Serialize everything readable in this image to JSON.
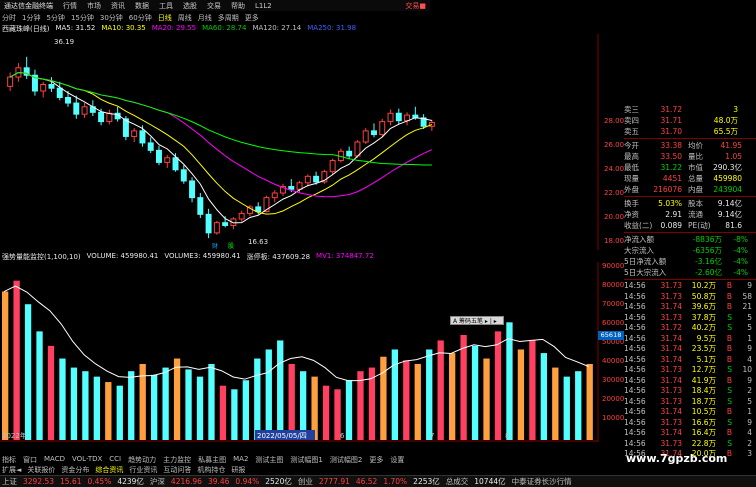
{
  "menubar": {
    "title": "通达信金融终端",
    "items": [
      "行情",
      "市场",
      "资讯",
      "数据",
      "工具",
      "选股",
      "交易",
      "帮助",
      "L1L2"
    ],
    "brand": "交易■"
  },
  "periods": {
    "items": [
      "分时",
      "1分钟",
      "5分钟",
      "15分钟",
      "30分钟",
      "60分钟",
      "日线",
      "周线",
      "月线",
      "多周期",
      "更多"
    ],
    "active": "日线"
  },
  "ma_legend": {
    "name": "西藏珠峰(日线)",
    "ma5": "MA5: 31.52",
    "ma10": "MA10: 30.35",
    "ma20": "MA20: 29.55",
    "ma60": "MA60: 28.74",
    "ma120": "MA120: 27.14",
    "ma250": "MA250: 31.98"
  },
  "vol_legend": {
    "name": "强势量能监控(1,100,10)",
    "volume": "VOLUME: 459980.41",
    "volume3": "VOLUME3: 459980.41",
    "zhangting": "涨停板: 437609.28",
    "mv1": "MV1: 374847.72"
  },
  "price_axis": [
    "28.00",
    "26.00",
    "24.00",
    "22.00",
    "20.00",
    "18.00"
  ],
  "vol_axis": [
    "90000",
    "80000",
    "70000",
    "60000",
    "50000",
    "40000",
    "30000",
    "20000",
    "10000"
  ],
  "chart_annotations": {
    "high": "36.19",
    "low": "16.63",
    "date_marker": "2022/05/05/四",
    "year_left": "2022年",
    "xaxis_labels": [
      "2022年",
      "2022/05/05/四",
      "6",
      "7",
      "8"
    ],
    "marker_cai": "财",
    "marker_gu": "股",
    "floating_btn": "A 筹码五笔 ▸ | ▸",
    "vol_marker": "65618"
  },
  "quote": {
    "ask": [
      {
        "label": "卖三",
        "price": "31.72",
        "vol": "3"
      },
      {
        "label": "卖四",
        "price": "31.71",
        "vol": "48.0万"
      },
      {
        "label": "卖五",
        "price": "31.70",
        "vol": "65.5万"
      }
    ],
    "rows": [
      {
        "k": "今开",
        "v": "33.38",
        "k2": "均价",
        "v2": "41.95"
      },
      {
        "k": "最高",
        "v": "33.50",
        "k2": "量比",
        "v2": "1.05"
      },
      {
        "k": "最低",
        "v": "31.22",
        "k2": "市值",
        "v2": "290.3亿"
      },
      {
        "k": "现量",
        "v": "4451",
        "k2": "总量",
        "v2": "459980"
      },
      {
        "k": "外盘",
        "v": "216076",
        "k2": "内盘",
        "v2": "243904"
      },
      {
        "k": "换手",
        "v": "5.03%",
        "k2": "股本",
        "v2": "9.14亿"
      },
      {
        "k": "净资",
        "v": "2.91",
        "k2": "流通",
        "v2": "9.14亿"
      },
      {
        "k": "收益(二)",
        "v": "0.089",
        "k2": "PE(动)",
        "v2": "81.6"
      }
    ],
    "flows": [
      {
        "label": "净流入额",
        "value": "-8836万",
        "pct": "-8%"
      },
      {
        "label": "大宗流入",
        "value": "-6356万",
        "pct": "-4%"
      },
      {
        "label": "5日净流入额",
        "value": "-3.16亿",
        "pct": "-4%"
      },
      {
        "label": "5日大宗流入",
        "value": "-2.60亿",
        "pct": "-4%"
      }
    ]
  },
  "trades": [
    {
      "t": "14:56",
      "p": "31.73",
      "v": "10.2万",
      "bs": "B",
      "n": "9"
    },
    {
      "t": "14:56",
      "p": "31.73",
      "v": "50.8万",
      "bs": "B",
      "n": "58"
    },
    {
      "t": "14:56",
      "p": "31.74",
      "v": "39.6万",
      "bs": "B",
      "n": "21"
    },
    {
      "t": "14:56",
      "p": "31.73",
      "v": "37.8万",
      "bs": "S",
      "n": "5"
    },
    {
      "t": "14:56",
      "p": "31.72",
      "v": "40.2万",
      "bs": "S",
      "n": "5"
    },
    {
      "t": "14:56",
      "p": "31.74",
      "v": "9.5万",
      "bs": "B",
      "n": "1"
    },
    {
      "t": "14:56",
      "p": "31.74",
      "v": "23.5万",
      "bs": "B",
      "n": "9"
    },
    {
      "t": "14:56",
      "p": "31.74",
      "v": "5.1万",
      "bs": "B",
      "n": "4"
    },
    {
      "t": "14:56",
      "p": "31.73",
      "v": "12.7万",
      "bs": "S",
      "n": "10"
    },
    {
      "t": "14:56",
      "p": "31.74",
      "v": "41.9万",
      "bs": "B",
      "n": "9"
    },
    {
      "t": "14:56",
      "p": "31.73",
      "v": "18.4万",
      "bs": "S",
      "n": "2"
    },
    {
      "t": "14:56",
      "p": "31.73",
      "v": "18.7万",
      "bs": "S",
      "n": "5"
    },
    {
      "t": "14:56",
      "p": "31.74",
      "v": "10.5万",
      "bs": "B",
      "n": "1"
    },
    {
      "t": "14:56",
      "p": "31.73",
      "v": "16.6万",
      "bs": "S",
      "n": "9"
    },
    {
      "t": "14:56",
      "p": "31.74",
      "v": "16.4万",
      "bs": "B",
      "n": "4"
    },
    {
      "t": "14:56",
      "p": "31.73",
      "v": "22.8万",
      "bs": "S",
      "n": "2"
    },
    {
      "t": "14:56",
      "p": "31.74",
      "v": "20.0万",
      "bs": "B",
      "n": "3"
    }
  ],
  "bottom_tabs": [
    "指标",
    "窗口",
    "MACD",
    "VOL-TDX",
    "CCI",
    "趋势动力",
    "主力监控",
    "私募主图",
    "MA2",
    "测试主图",
    "测试幅图1",
    "测试幅图2",
    "更多",
    "设置"
  ],
  "bottom_tabs2": [
    "扩展◄",
    "关联报价",
    "资金分布",
    "综合资讯",
    "行业资讯",
    "互动问答",
    "机构持仓",
    "研报"
  ],
  "bottom_right": "图文F10 财经",
  "status": {
    "sh": {
      "label": "上证",
      "value": "3292.53",
      "chg": "15.61",
      "pct": "0.45%",
      "amt": "4239亿"
    },
    "sz": {
      "label": "沪深",
      "value": "4216.96",
      "chg": "39.46",
      "pct": "0.94%",
      "amt": "2520亿"
    },
    "cy": {
      "label": "创业",
      "value": "2777.91",
      "chg": "46.52",
      "pct": "1.70%",
      "amt": "2253亿"
    },
    "total": {
      "label": "总成交",
      "value": "10744亿"
    },
    "news": "中泰证券长沙行情"
  },
  "watermark": "www.7gpzb.com",
  "colors": {
    "up": "#ff4040",
    "down": "#54ffff",
    "ma5": "#ffffff",
    "ma10": "#ffff00",
    "ma20": "#ff00ff",
    "ma60": "#00ff00",
    "ma120": "#c0c0c0"
  },
  "chart_data": {
    "type": "candlestick",
    "ylim": [
      16,
      38
    ],
    "ohlc": [
      [
        33.0,
        34.5,
        32.5,
        34.0
      ],
      [
        34.0,
        35.5,
        33.5,
        35.0
      ],
      [
        35.0,
        36.19,
        33.8,
        34.2
      ],
      [
        34.2,
        34.8,
        32.0,
        32.5
      ],
      [
        32.5,
        33.5,
        31.8,
        33.2
      ],
      [
        33.2,
        34.0,
        32.4,
        32.8
      ],
      [
        32.8,
        33.5,
        31.5,
        31.8
      ],
      [
        31.8,
        32.5,
        30.8,
        31.2
      ],
      [
        31.2,
        32.0,
        29.5,
        30.0
      ],
      [
        30.0,
        31.2,
        29.6,
        30.8
      ],
      [
        30.8,
        31.5,
        29.8,
        30.2
      ],
      [
        30.2,
        30.6,
        28.8,
        29.2
      ],
      [
        29.2,
        30.5,
        28.9,
        30.1
      ],
      [
        30.1,
        30.8,
        29.2,
        29.5
      ],
      [
        29.5,
        29.8,
        27.2,
        27.6
      ],
      [
        27.6,
        28.5,
        27.0,
        28.2
      ],
      [
        28.2,
        28.8,
        26.5,
        26.9
      ],
      [
        26.9,
        27.5,
        25.8,
        26.1
      ],
      [
        26.1,
        26.6,
        24.5,
        24.8
      ],
      [
        24.8,
        25.6,
        24.2,
        25.3
      ],
      [
        25.3,
        25.8,
        23.8,
        24.0
      ],
      [
        24.0,
        24.5,
        22.5,
        22.8
      ],
      [
        22.8,
        23.2,
        20.5,
        21.0
      ],
      [
        21.0,
        21.5,
        18.8,
        19.2
      ],
      [
        19.2,
        19.8,
        16.63,
        17.2
      ],
      [
        17.2,
        18.5,
        17.0,
        18.3
      ],
      [
        18.3,
        19.0,
        17.8,
        18.0
      ],
      [
        18.0,
        18.9,
        17.6,
        18.7
      ],
      [
        18.7,
        19.6,
        18.4,
        19.3
      ],
      [
        19.3,
        20.2,
        19.0,
        20.0
      ],
      [
        20.0,
        20.5,
        19.2,
        19.5
      ],
      [
        19.5,
        21.2,
        19.4,
        21.0
      ],
      [
        21.0,
        21.8,
        20.5,
        21.5
      ],
      [
        21.5,
        22.5,
        21.2,
        22.2
      ],
      [
        22.2,
        23.0,
        21.6,
        21.9
      ],
      [
        21.9,
        22.8,
        21.5,
        22.6
      ],
      [
        22.6,
        23.5,
        22.2,
        23.3
      ],
      [
        23.3,
        23.8,
        22.4,
        22.7
      ],
      [
        22.7,
        24.0,
        22.5,
        23.8
      ],
      [
        23.8,
        25.2,
        23.5,
        25.0
      ],
      [
        25.0,
        26.3,
        24.8,
        26.0
      ],
      [
        26.0,
        26.5,
        25.2,
        25.5
      ],
      [
        25.5,
        27.2,
        25.3,
        27.0
      ],
      [
        27.0,
        28.5,
        26.8,
        28.2
      ],
      [
        28.2,
        29.0,
        27.5,
        27.8
      ],
      [
        27.8,
        29.5,
        27.6,
        29.2
      ],
      [
        29.2,
        30.5,
        28.8,
        30.1
      ],
      [
        30.1,
        30.6,
        28.9,
        29.3
      ],
      [
        29.3,
        30.2,
        28.8,
        29.9
      ],
      [
        29.9,
        30.8,
        29.4,
        29.6
      ],
      [
        29.6,
        30.0,
        28.4,
        28.7
      ],
      [
        28.7,
        29.4,
        28.2,
        29.1
      ]
    ],
    "volumes": [
      82,
      88,
      75,
      60,
      52,
      45,
      40,
      38,
      35,
      32,
      30,
      38,
      42,
      36,
      40,
      45,
      39,
      35,
      42,
      30,
      28,
      33,
      45,
      50,
      55,
      42,
      38,
      35,
      30,
      28,
      33,
      38,
      40,
      46,
      50,
      44,
      42,
      50,
      55,
      48,
      58,
      52,
      45,
      60,
      65,
      50,
      55,
      48,
      40,
      35,
      38,
      42
    ],
    "vol_ylim": [
      0,
      95
    ]
  }
}
